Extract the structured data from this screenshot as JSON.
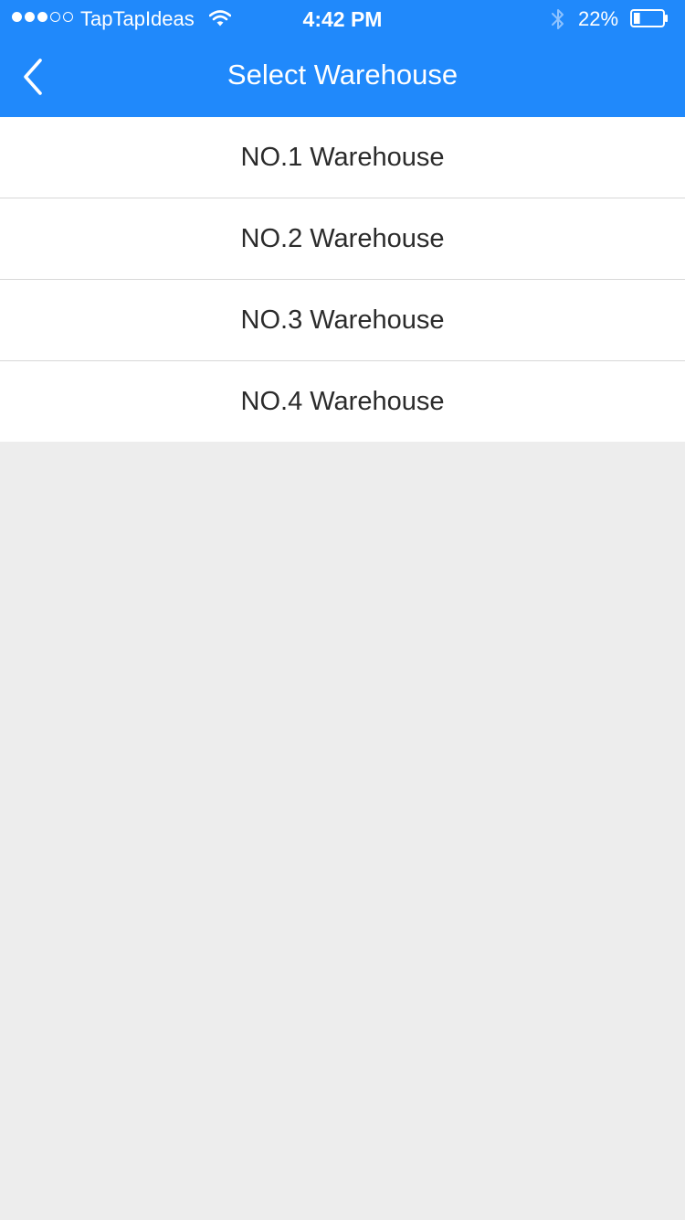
{
  "status_bar": {
    "carrier": "TapTapIdeas",
    "time": "4:42 PM",
    "battery": "22%",
    "battery_level": 0.22,
    "signal_bars_filled": 3,
    "signal_bars_total": 5,
    "icons": [
      "wifi-icon",
      "bluetooth-icon",
      "battery-icon"
    ]
  },
  "nav": {
    "title": "Select Warehouse",
    "back_icon": "chevron-left-icon"
  },
  "warehouses": [
    {
      "label": "NO.1 Warehouse"
    },
    {
      "label": "NO.2 Warehouse"
    },
    {
      "label": "NO.3 Warehouse"
    },
    {
      "label": "NO.4 Warehouse"
    }
  ],
  "colors": {
    "header_bg": "#2089fb",
    "page_bg": "#ededed",
    "list_bg": "#ffffff",
    "text": "#2b2b2b"
  }
}
